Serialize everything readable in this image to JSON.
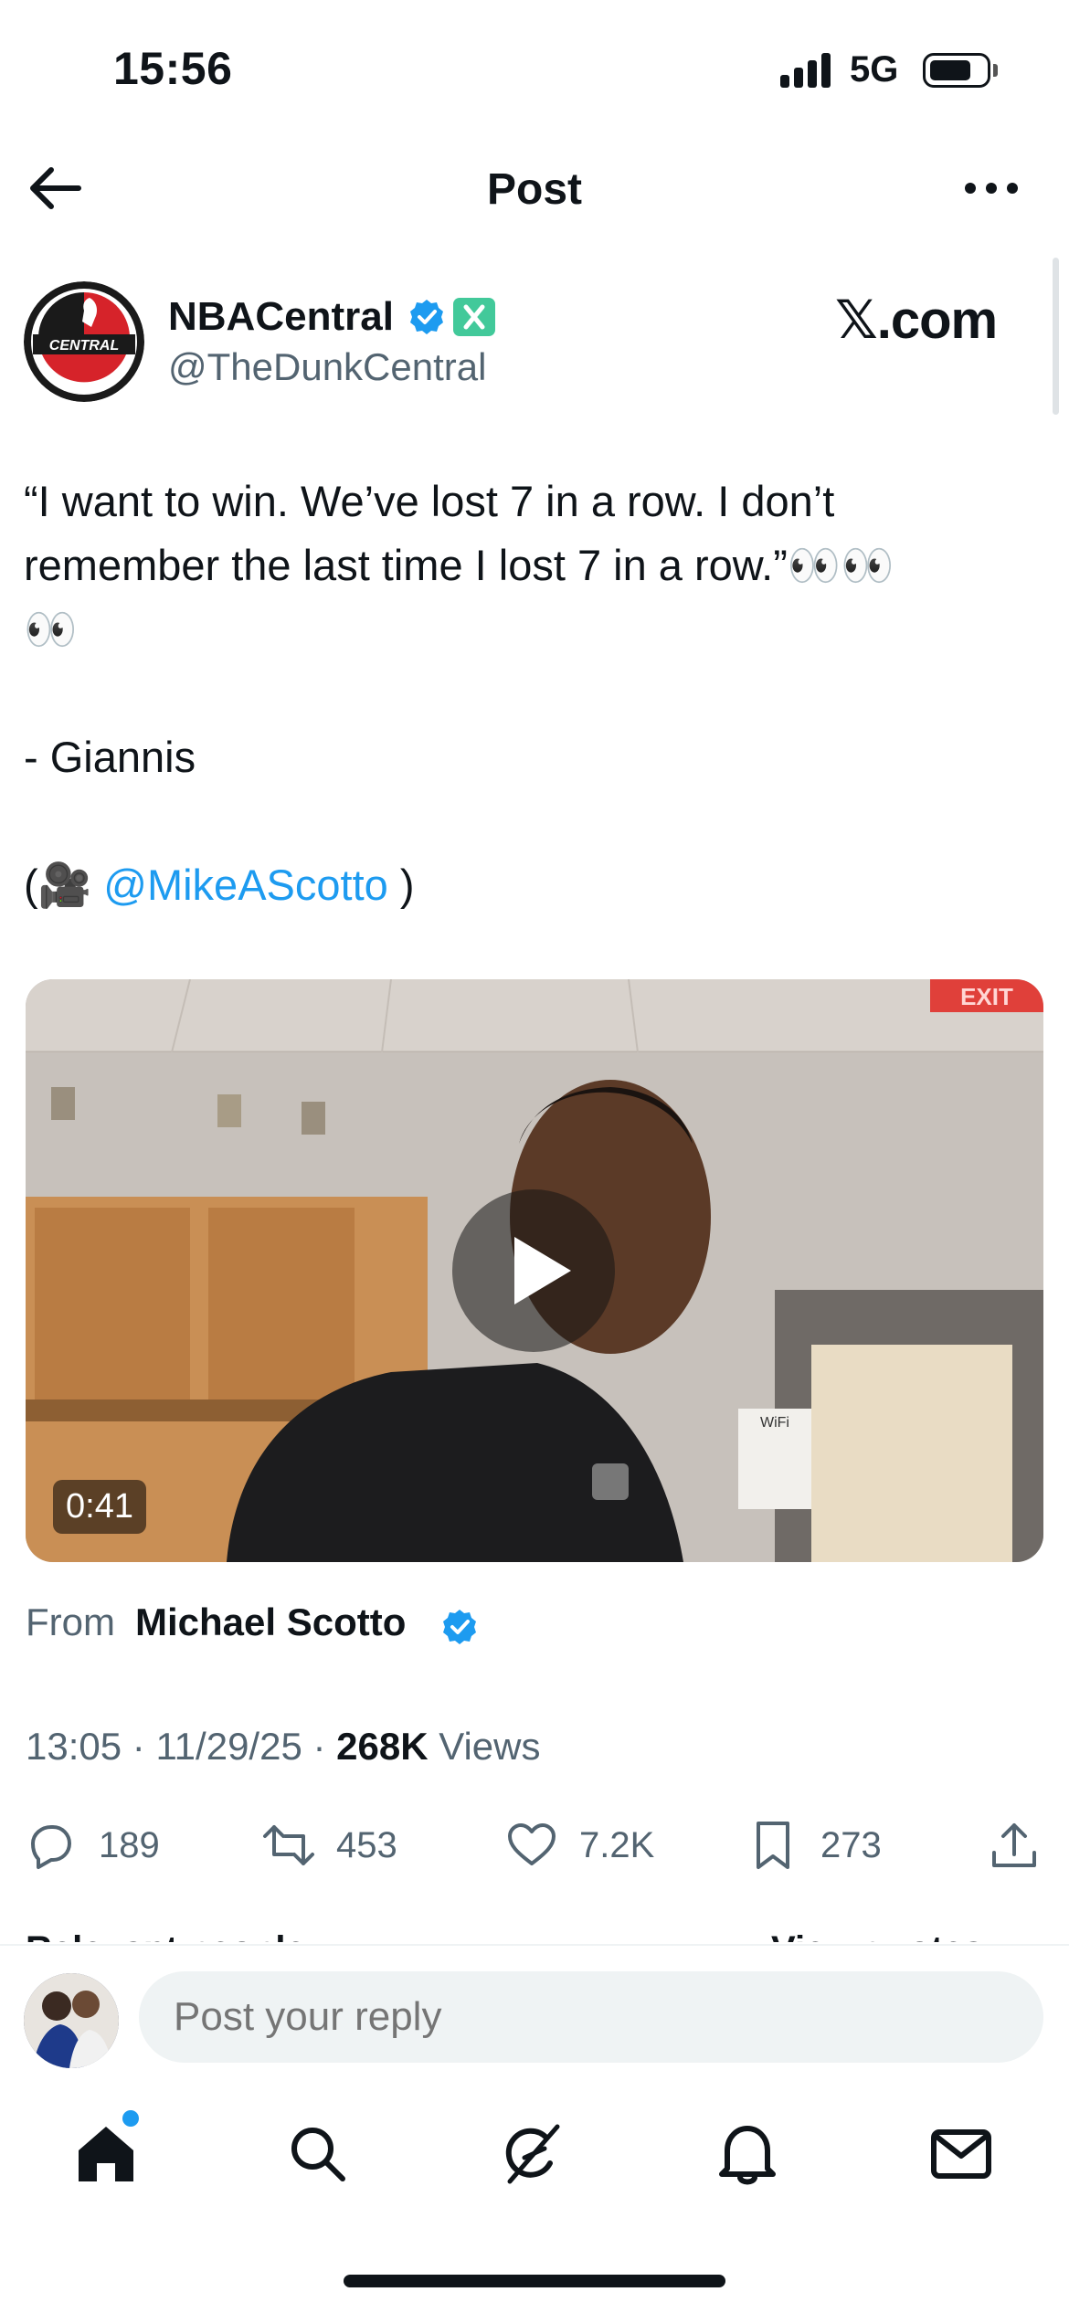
{
  "status_bar": {
    "time": "15:56",
    "network": "5G"
  },
  "header": {
    "title": "Post"
  },
  "post": {
    "author_name": "NBACentral",
    "author_handle": "@TheDunkCentral",
    "source_label": "𝕏.com",
    "avatar_text": "CENTRAL",
    "text_line1": "“I want to win. We’ve lost 7 in a row. I don’t",
    "text_line2": "remember the last time I lost 7 in a row.”👀👀",
    "text_line3": "👀",
    "text_line4": "- Giannis",
    "text_paren_open": "(",
    "text_camera": "🎥",
    "text_mention": "@MikeAScotto",
    "text_paren_close": " )"
  },
  "media": {
    "duration": "0:41",
    "exit_sign": "EXIT",
    "wifi_sign": "WiFi"
  },
  "attribution": {
    "from_label": "From",
    "from_name": "Michael Scotto"
  },
  "meta": {
    "time": "13:05",
    "separator": " · ",
    "date": "11/29/25",
    "views_count": "268K",
    "views_label": " Views"
  },
  "actions": {
    "replies": "189",
    "reposts": "453",
    "likes": "7.2K",
    "bookmarks": "273"
  },
  "cutoff": {
    "left": "Relevant people",
    "right": "View quotes"
  },
  "reply": {
    "placeholder": "Post your reply"
  },
  "colors": {
    "accent": "#1d9bf0",
    "text": "#0f1419",
    "secondary": "#536471",
    "xpremium": "#42c99a"
  },
  "icons": [
    "back-arrow-icon",
    "more-icon",
    "verified-icon",
    "x-premium-icon",
    "play-icon",
    "reply-icon",
    "repost-icon",
    "like-icon",
    "bookmark-icon",
    "share-icon",
    "home-icon",
    "search-icon",
    "grok-icon",
    "bell-icon",
    "mail-icon"
  ]
}
